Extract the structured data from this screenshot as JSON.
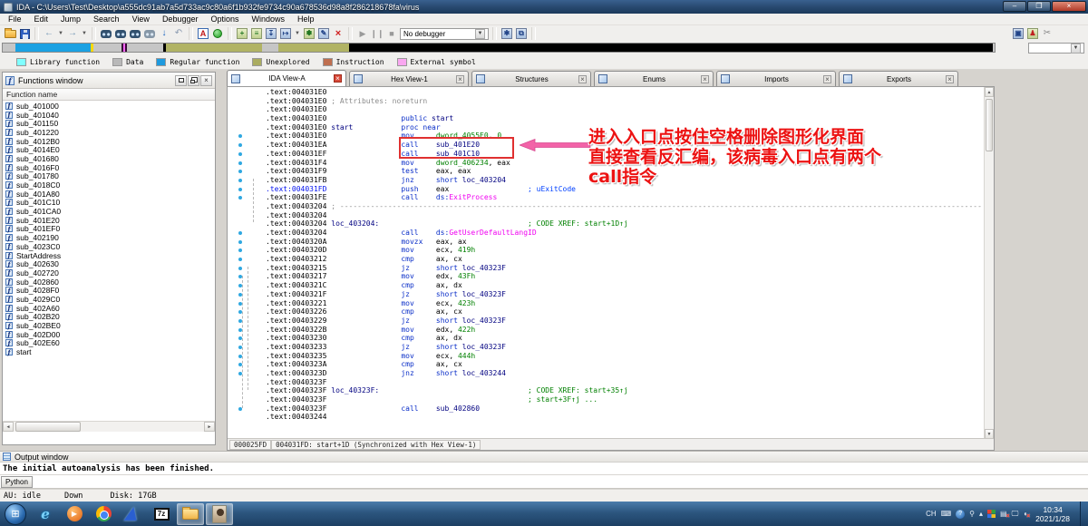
{
  "titlebar": {
    "title": "IDA - C:\\Users\\Test\\Desktop\\a555dc91ab7a5d733ac9c80a6f1b932fe9734c90a678536d98a8f286218678fa\\virus"
  },
  "menu": {
    "items": [
      "File",
      "Edit",
      "Jump",
      "Search",
      "View",
      "Debugger",
      "Options",
      "Windows",
      "Help"
    ]
  },
  "toolbar": {
    "debugger_label": "No debugger"
  },
  "legend": {
    "items": [
      {
        "label": "Library function",
        "color": "#80ffff"
      },
      {
        "label": "Data",
        "color": "#b9b9b9"
      },
      {
        "label": "Regular function",
        "color": "#1e9ade"
      },
      {
        "label": "Unexplored",
        "color": "#aaac60"
      },
      {
        "label": "Instruction",
        "color": "#bf6f4f"
      },
      {
        "label": "External symbol",
        "color": "#f9a7f0"
      }
    ]
  },
  "functions_panel": {
    "title": "Functions window",
    "column_header": "Function name",
    "items": [
      "sub_401000",
      "sub_401040",
      "sub_401150",
      "sub_401220",
      "sub_4012B0",
      "sub_4014E0",
      "sub_401680",
      "sub_4016F0",
      "sub_401780",
      "sub_4018C0",
      "sub_401A80",
      "sub_401C10",
      "sub_401CA0",
      "sub_401E20",
      "sub_401EF0",
      "sub_402190",
      "sub_4023C0",
      "StartAddress",
      "sub_402630",
      "sub_402720",
      "sub_402860",
      "sub_4028F0",
      "sub_4029C0",
      "sub_402A60",
      "sub_402B20",
      "sub_402BE0",
      "sub_402D00",
      "sub_402E60",
      "start"
    ]
  },
  "tabs": [
    {
      "label": "IDA View-A",
      "icon": "ida-view-icon",
      "active": true
    },
    {
      "label": "Hex View-1",
      "icon": "hex-view-icon",
      "active": false
    },
    {
      "label": "Structures",
      "icon": "structures-icon",
      "active": false
    },
    {
      "label": "Enums",
      "icon": "enums-icon",
      "active": false
    },
    {
      "label": "Imports",
      "icon": "imports-icon",
      "active": false
    },
    {
      "label": "Exports",
      "icon": "exports-icon",
      "active": false
    }
  ],
  "disassembly": {
    "status_left": "000025FD",
    "status_main": "004031FD: start+1D (Synchronized with Hex View-1)",
    "lines": [
      {
        "dot": false,
        "tokens": [
          [
            "a",
            ".text:004031E0"
          ]
        ]
      },
      {
        "dot": false,
        "tokens": [
          [
            "a",
            ".text:004031E0"
          ],
          [
            "g",
            " ; Attributes: noreturn"
          ]
        ]
      },
      {
        "dot": false,
        "tokens": [
          [
            "a",
            ".text:004031E0"
          ]
        ]
      },
      {
        "dot": false,
        "tokens": [
          [
            "a",
            ".text:004031E0"
          ],
          [
            "r",
            "                 "
          ],
          [
            "m",
            "public "
          ],
          [
            "n",
            "start"
          ]
        ]
      },
      {
        "dot": false,
        "tokens": [
          [
            "a",
            ".text:004031E0"
          ],
          [
            "r",
            " "
          ],
          [
            "n",
            "start"
          ],
          [
            "r",
            "           "
          ],
          [
            "m",
            "proc near"
          ]
        ]
      },
      {
        "dot": true,
        "tokens": [
          [
            "a",
            ".text:004031E0"
          ],
          [
            "r",
            "                 "
          ],
          [
            "m",
            "mov"
          ],
          [
            "r",
            "     "
          ],
          [
            "d",
            "dword_4055E0"
          ],
          [
            "r",
            ", "
          ],
          [
            "d",
            "0"
          ]
        ]
      },
      {
        "dot": true,
        "tokens": [
          [
            "a",
            ".text:004031EA"
          ],
          [
            "r",
            "                 "
          ],
          [
            "m",
            "call"
          ],
          [
            "r",
            "    "
          ],
          [
            "n",
            "sub_401E20"
          ]
        ]
      },
      {
        "dot": true,
        "tokens": [
          [
            "a",
            ".text:004031EF"
          ],
          [
            "r",
            "                 "
          ],
          [
            "m",
            "call"
          ],
          [
            "r",
            "    "
          ],
          [
            "n",
            "sub_401C10"
          ]
        ]
      },
      {
        "dot": true,
        "tokens": [
          [
            "a",
            ".text:004031F4"
          ],
          [
            "r",
            "                 "
          ],
          [
            "m",
            "mov"
          ],
          [
            "r",
            "     "
          ],
          [
            "d",
            "dword_406234"
          ],
          [
            "r",
            ", eax"
          ]
        ]
      },
      {
        "dot": true,
        "tokens": [
          [
            "a",
            ".text:004031F9"
          ],
          [
            "r",
            "                 "
          ],
          [
            "m",
            "test"
          ],
          [
            "r",
            "    "
          ],
          [
            "r",
            "eax, eax"
          ]
        ]
      },
      {
        "dot": true,
        "tokens": [
          [
            "a",
            ".text:004031FB"
          ],
          [
            "r",
            "                 "
          ],
          [
            "m",
            "jnz"
          ],
          [
            "r",
            "     "
          ],
          [
            "m",
            "short "
          ],
          [
            "n",
            "loc_403204"
          ]
        ]
      },
      {
        "dot": true,
        "tokens": [
          [
            "ah",
            ".text:004031FD"
          ],
          [
            "r",
            "                 "
          ],
          [
            "m",
            "push"
          ],
          [
            "r",
            "    "
          ],
          [
            "r",
            "eax"
          ],
          [
            "r",
            "                  "
          ],
          [
            "c",
            "; uExitCode"
          ]
        ]
      },
      {
        "dot": true,
        "tokens": [
          [
            "a",
            ".text:004031FE"
          ],
          [
            "r",
            "                 "
          ],
          [
            "m",
            "call"
          ],
          [
            "r",
            "    "
          ],
          [
            "m",
            "ds:"
          ],
          [
            "api",
            "ExitProcess"
          ]
        ]
      },
      {
        "dot": false,
        "tokens": [
          [
            "a",
            ".text:00403204"
          ],
          [
            "g",
            " ; ---------------------------------------------------------------------------------------------------------------------------------------------------"
          ]
        ]
      },
      {
        "dot": false,
        "tokens": [
          [
            "a",
            ".text:00403204"
          ]
        ]
      },
      {
        "dot": false,
        "tokens": [
          [
            "a",
            ".text:00403204"
          ],
          [
            "r",
            " "
          ],
          [
            "n",
            "loc_403204:"
          ],
          [
            "r",
            "                                  "
          ],
          [
            "d",
            "; CODE XREF: start+1D↑j"
          ]
        ]
      },
      {
        "dot": true,
        "tokens": [
          [
            "a",
            ".text:00403204"
          ],
          [
            "r",
            "                 "
          ],
          [
            "m",
            "call"
          ],
          [
            "r",
            "    "
          ],
          [
            "m",
            "ds:"
          ],
          [
            "api",
            "GetUserDefaultLangID"
          ]
        ]
      },
      {
        "dot": true,
        "tokens": [
          [
            "a",
            ".text:0040320A"
          ],
          [
            "r",
            "                 "
          ],
          [
            "m",
            "movzx"
          ],
          [
            "r",
            "   "
          ],
          [
            "r",
            "eax, ax"
          ]
        ]
      },
      {
        "dot": true,
        "tokens": [
          [
            "a",
            ".text:0040320D"
          ],
          [
            "r",
            "                 "
          ],
          [
            "m",
            "mov"
          ],
          [
            "r",
            "     "
          ],
          [
            "r",
            "ecx, "
          ],
          [
            "d",
            "419h"
          ]
        ]
      },
      {
        "dot": true,
        "tokens": [
          [
            "a",
            ".text:00403212"
          ],
          [
            "r",
            "                 "
          ],
          [
            "m",
            "cmp"
          ],
          [
            "r",
            "     "
          ],
          [
            "r",
            "ax, cx"
          ]
        ]
      },
      {
        "dot": true,
        "tokens": [
          [
            "a",
            ".text:00403215"
          ],
          [
            "r",
            "                 "
          ],
          [
            "m",
            "jz"
          ],
          [
            "r",
            "      "
          ],
          [
            "m",
            "short "
          ],
          [
            "n",
            "loc_40323F"
          ]
        ]
      },
      {
        "dot": true,
        "tokens": [
          [
            "a",
            ".text:00403217"
          ],
          [
            "r",
            "                 "
          ],
          [
            "m",
            "mov"
          ],
          [
            "r",
            "     "
          ],
          [
            "r",
            "edx, "
          ],
          [
            "d",
            "43Fh"
          ]
        ]
      },
      {
        "dot": true,
        "tokens": [
          [
            "a",
            ".text:0040321C"
          ],
          [
            "r",
            "                 "
          ],
          [
            "m",
            "cmp"
          ],
          [
            "r",
            "     "
          ],
          [
            "r",
            "ax, dx"
          ]
        ]
      },
      {
        "dot": true,
        "tokens": [
          [
            "a",
            ".text:0040321F"
          ],
          [
            "r",
            "                 "
          ],
          [
            "m",
            "jz"
          ],
          [
            "r",
            "      "
          ],
          [
            "m",
            "short "
          ],
          [
            "n",
            "loc_40323F"
          ]
        ]
      },
      {
        "dot": true,
        "tokens": [
          [
            "a",
            ".text:00403221"
          ],
          [
            "r",
            "                 "
          ],
          [
            "m",
            "mov"
          ],
          [
            "r",
            "     "
          ],
          [
            "r",
            "ecx, "
          ],
          [
            "d",
            "423h"
          ]
        ]
      },
      {
        "dot": true,
        "tokens": [
          [
            "a",
            ".text:00403226"
          ],
          [
            "r",
            "                 "
          ],
          [
            "m",
            "cmp"
          ],
          [
            "r",
            "     "
          ],
          [
            "r",
            "ax, cx"
          ]
        ]
      },
      {
        "dot": true,
        "tokens": [
          [
            "a",
            ".text:00403229"
          ],
          [
            "r",
            "                 "
          ],
          [
            "m",
            "jz"
          ],
          [
            "r",
            "      "
          ],
          [
            "m",
            "short "
          ],
          [
            "n",
            "loc_40323F"
          ]
        ]
      },
      {
        "dot": true,
        "tokens": [
          [
            "a",
            ".text:0040322B"
          ],
          [
            "r",
            "                 "
          ],
          [
            "m",
            "mov"
          ],
          [
            "r",
            "     "
          ],
          [
            "r",
            "edx, "
          ],
          [
            "d",
            "422h"
          ]
        ]
      },
      {
        "dot": true,
        "tokens": [
          [
            "a",
            ".text:00403230"
          ],
          [
            "r",
            "                 "
          ],
          [
            "m",
            "cmp"
          ],
          [
            "r",
            "     "
          ],
          [
            "r",
            "ax, dx"
          ]
        ]
      },
      {
        "dot": true,
        "tokens": [
          [
            "a",
            ".text:00403233"
          ],
          [
            "r",
            "                 "
          ],
          [
            "m",
            "jz"
          ],
          [
            "r",
            "      "
          ],
          [
            "m",
            "short "
          ],
          [
            "n",
            "loc_40323F"
          ]
        ]
      },
      {
        "dot": true,
        "tokens": [
          [
            "a",
            ".text:00403235"
          ],
          [
            "r",
            "                 "
          ],
          [
            "m",
            "mov"
          ],
          [
            "r",
            "     "
          ],
          [
            "r",
            "ecx, "
          ],
          [
            "d",
            "444h"
          ]
        ]
      },
      {
        "dot": true,
        "tokens": [
          [
            "a",
            ".text:0040323A"
          ],
          [
            "r",
            "                 "
          ],
          [
            "m",
            "cmp"
          ],
          [
            "r",
            "     "
          ],
          [
            "r",
            "ax, cx"
          ]
        ]
      },
      {
        "dot": true,
        "tokens": [
          [
            "a",
            ".text:0040323D"
          ],
          [
            "r",
            "                 "
          ],
          [
            "m",
            "jnz"
          ],
          [
            "r",
            "     "
          ],
          [
            "m",
            "short "
          ],
          [
            "n",
            "loc_403244"
          ]
        ]
      },
      {
        "dot": false,
        "tokens": [
          [
            "a",
            ".text:0040323F"
          ]
        ]
      },
      {
        "dot": false,
        "tokens": [
          [
            "a",
            ".text:0040323F"
          ],
          [
            "r",
            " "
          ],
          [
            "n",
            "loc_40323F:"
          ],
          [
            "r",
            "                                  "
          ],
          [
            "d",
            "; CODE XREF: start+35↑j"
          ]
        ]
      },
      {
        "dot": false,
        "tokens": [
          [
            "a",
            ".text:0040323F"
          ],
          [
            "r",
            "                                              "
          ],
          [
            "d",
            "; start+3F↑j ..."
          ]
        ]
      },
      {
        "dot": true,
        "tokens": [
          [
            "a",
            ".text:0040323F"
          ],
          [
            "r",
            "                 "
          ],
          [
            "m",
            "call"
          ],
          [
            "r",
            "    "
          ],
          [
            "n",
            "sub_402860"
          ]
        ]
      },
      {
        "dot": false,
        "tokens": [
          [
            "a",
            ".text:00403244"
          ]
        ]
      }
    ]
  },
  "annotation": {
    "color": "#ec1212",
    "arrow_color": "#f263a8",
    "text_lines": [
      "进入入口点按住空格删除图形化界面",
      "直接查看反汇编，该病毒入口点有两个",
      "call指令"
    ]
  },
  "output": {
    "title": "Output window",
    "log": "The initial autoanalysis has been finished.",
    "prompt": "Python"
  },
  "statusbar": {
    "au": "AU: idle",
    "state": "Down",
    "disk": "Disk: 17GB"
  },
  "taskbar": {
    "sevenzip_label": "7z",
    "tray_lang": "CH",
    "time": "10:34",
    "date": "2021/1/28"
  }
}
